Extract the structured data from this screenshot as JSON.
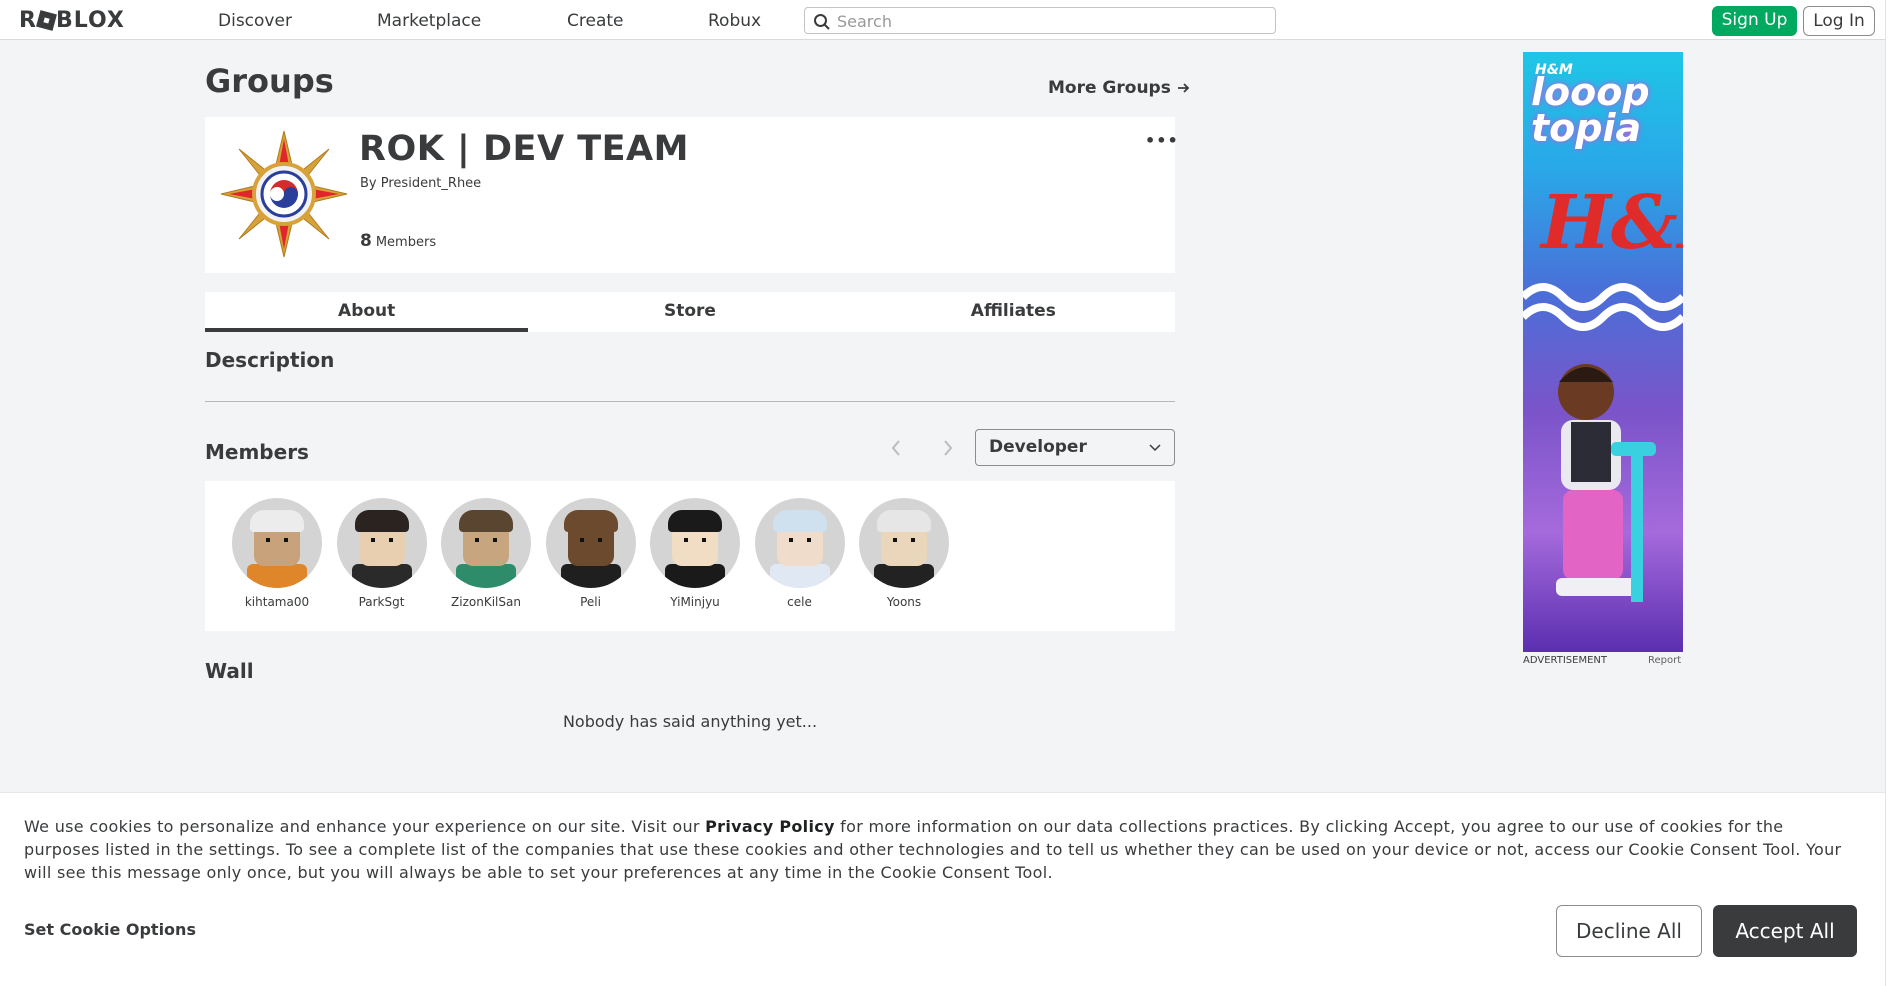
{
  "nav": {
    "logo": "ROBLOX",
    "links": [
      "Discover",
      "Marketplace",
      "Create",
      "Robux"
    ],
    "search_placeholder": "Search",
    "signup_label": "Sign Up",
    "login_label": "Log In"
  },
  "page": {
    "title": "Groups",
    "more_groups": "More Groups"
  },
  "group": {
    "name": "ROK | DEV TEAM",
    "by_label": "By",
    "owner": "President_Rhee",
    "member_count": "8",
    "members_label": "Members",
    "menu": "•••"
  },
  "tabs": [
    "About",
    "Store",
    "Affiliates"
  ],
  "sections": {
    "description": "Description",
    "members": "Members",
    "wall": "Wall",
    "wall_empty": "Nobody has said anything yet..."
  },
  "members": {
    "role_selected": "Developer",
    "list": [
      {
        "name": "kihtama00",
        "skin": "#c8a27a",
        "shirt": "#e0862a",
        "hat": "#ececec"
      },
      {
        "name": "ParkSgt",
        "skin": "#e8cfb0",
        "shirt": "#2a2a2a",
        "hat": "#2b2320"
      },
      {
        "name": "ZizonKilSan",
        "skin": "#c7a57e",
        "shirt": "#2f8c6a",
        "hat": "#5a4530"
      },
      {
        "name": "Peli",
        "skin": "#6b4a2e",
        "shirt": "#1f1f1f",
        "hat": "#6b4a2e"
      },
      {
        "name": "YiMinjyu",
        "skin": "#f1dcc4",
        "shirt": "#1a1a1a",
        "hat": "#1a1a1a"
      },
      {
        "name": "cele",
        "skin": "#f0dccb",
        "shirt": "#dfe8f3",
        "hat": "#cfe0ee"
      },
      {
        "name": "Yoons",
        "skin": "#ead6bb",
        "shirt": "#222222",
        "hat": "#e6e6e6"
      }
    ]
  },
  "ad": {
    "brand_small": "H&M",
    "headline": "looop topia",
    "brand_big": "H&M",
    "label": "ADVERTISEMENT",
    "report": "Report"
  },
  "cookie": {
    "text_before": "We use cookies to personalize and enhance your experience on our site. Visit our ",
    "privacy_link": "Privacy Policy",
    "text_after": " for more information on our data collections practices. By clicking Accept, you agree to our use of cookies for the purposes listed in the settings. To see a complete list of the companies that use these cookies and other technologies and to tell us whether they can be used on your device or not, access our Cookie Consent Tool. Your will see this message only once, but you will always be able to set your preferences at any time in the Cookie Consent Tool.",
    "options_label": "Set Cookie Options",
    "decline_label": "Decline All",
    "accept_label": "Accept All"
  },
  "colors": {
    "signup": "#00a960",
    "accept": "#393b3d",
    "background": "#f2f4f5"
  }
}
